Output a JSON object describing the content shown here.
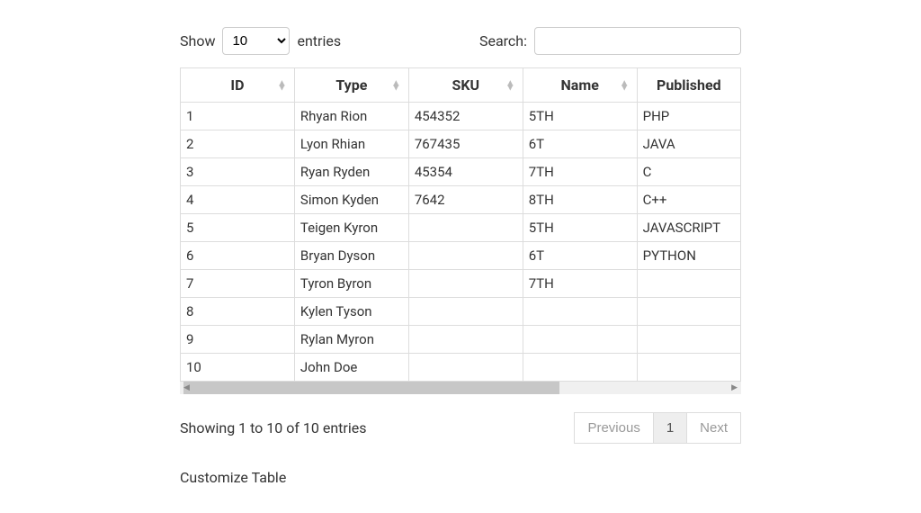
{
  "length": {
    "show_label": "Show",
    "entries_label": "entries",
    "selected": "10"
  },
  "search": {
    "label": "Search:",
    "value": ""
  },
  "columns": [
    {
      "key": "id",
      "label": "ID"
    },
    {
      "key": "type",
      "label": "Type"
    },
    {
      "key": "sku",
      "label": "SKU"
    },
    {
      "key": "name",
      "label": "Name"
    },
    {
      "key": "published",
      "label": "Published"
    }
  ],
  "rows": [
    {
      "id": "1",
      "type": "Rhyan Rion",
      "sku": "454352",
      "name": "5TH",
      "published": "PHP"
    },
    {
      "id": "2",
      "type": "Lyon Rhian",
      "sku": "767435",
      "name": "6T",
      "published": "JAVA"
    },
    {
      "id": "3",
      "type": "Ryan Ryden",
      "sku": "45354",
      "name": "7TH",
      "published": "C"
    },
    {
      "id": "4",
      "type": "Simon Kyden",
      "sku": "7642",
      "name": "8TH",
      "published": "C++"
    },
    {
      "id": "5",
      "type": "Teigen Kyron",
      "sku": "",
      "name": "5TH",
      "published": "JAVASCRIPT"
    },
    {
      "id": "6",
      "type": "Bryan Dyson",
      "sku": "",
      "name": "6T",
      "published": "PYTHON"
    },
    {
      "id": "7",
      "type": "Tyron Byron",
      "sku": "",
      "name": "7TH",
      "published": ""
    },
    {
      "id": "8",
      "type": "Kylen Tyson",
      "sku": "",
      "name": "",
      "published": ""
    },
    {
      "id": "9",
      "type": "Rylan Myron",
      "sku": "",
      "name": "",
      "published": ""
    },
    {
      "id": "10",
      "type": "John Doe",
      "sku": "",
      "name": "",
      "published": ""
    }
  ],
  "info": "Showing 1 to 10 of 10 entries",
  "pagination": {
    "previous_label": "Previous",
    "page_label": "1",
    "next_label": "Next"
  },
  "customize_label": "Customize Table"
}
